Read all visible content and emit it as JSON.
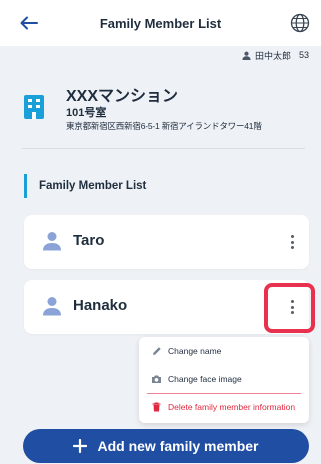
{
  "header": {
    "title": "Family Member List",
    "back_icon": "arrow-left-icon",
    "language_icon": "globe-icon"
  },
  "user": {
    "icon": "person-icon",
    "name": "田中太郎",
    "id": "53"
  },
  "building": {
    "icon": "building-icon",
    "name": "XXXマンション",
    "room": "101号室",
    "address": "東京都新宿区西新宿6-5-1 新宿アイランドタワー41階"
  },
  "section": {
    "title": "Family Member List"
  },
  "members": [
    {
      "name": "Taro",
      "icon": "person-icon"
    },
    {
      "name": "Hanako",
      "icon": "person-icon"
    }
  ],
  "context_menu": {
    "items": [
      {
        "label": "Change name",
        "icon": "pencil-icon"
      },
      {
        "label": "Change face image",
        "icon": "camera-icon"
      },
      {
        "label": "Delete family member information",
        "icon": "trash-icon"
      }
    ]
  },
  "add_button": {
    "label": "Add new family member",
    "icon": "plus-icon"
  },
  "colors": {
    "primary": "#1f4ea3",
    "accent": "#1aa0d8",
    "danger": "#e0283f",
    "highlight": "#e8304f",
    "background": "#eef1f5"
  }
}
